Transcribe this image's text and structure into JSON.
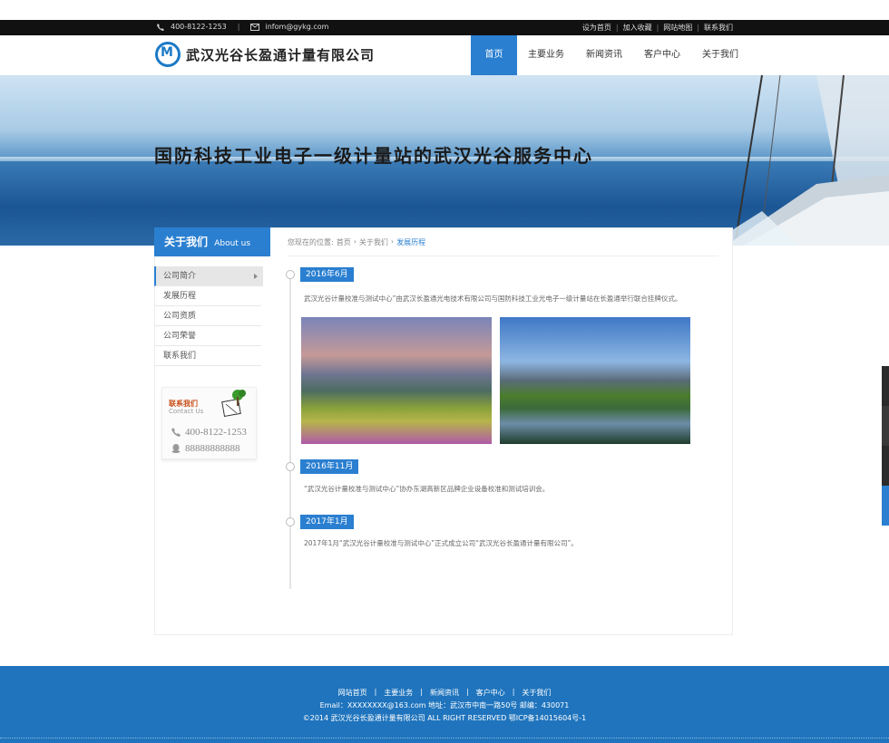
{
  "topbar": {
    "phone": "400-8122-1253",
    "email": "infom@gykg.com",
    "links": [
      "设为首页",
      "加入收藏",
      "网站地图",
      "联系我们"
    ]
  },
  "header": {
    "company_name": "武汉光谷长盈通计量有限公司",
    "nav": [
      "首页",
      "主要业务",
      "新闻资讯",
      "客户中心",
      "关于我们"
    ],
    "active_nav": "首页"
  },
  "banner": {
    "slogan": "国防科技工业电子一级计量站的武汉光谷服务中心"
  },
  "sidebar": {
    "title": "关于我们",
    "title_en": "About us",
    "items": [
      "公司简介",
      "发展历程",
      "公司资质",
      "公司荣誉",
      "联系我们"
    ],
    "active_item": "公司简介",
    "contact": {
      "title": "联系我们",
      "title_en": "Contact Us",
      "phone": "400-8122-1253",
      "qq": "88888888888"
    }
  },
  "breadcrumb": {
    "prefix": "您现在的位置:",
    "items": [
      "首页",
      "关于我们",
      "发展历程"
    ]
  },
  "timeline": [
    {
      "date": "2016年6月",
      "text": "武汉光谷计量校准与测试中心”由武汉长盈通光电技术有限公司与国防科技工业光电子一级计量站在长盈通举行联合挂牌仪式。"
    },
    {
      "date": "2016年11月",
      "text": "“武汉光谷计量校准与测试中心”协办东湖高新区品牌企业设备校准和测试培训会。"
    },
    {
      "date": "2017年1月",
      "text": "2017年1月“武汉光谷计量校准与测试中心”正式成立公司“武汉光谷长盈通计量有限公司”。"
    }
  ],
  "footer": {
    "links": [
      "网站首页",
      "主要业务",
      "新闻资讯",
      "客户中心",
      "关于我们"
    ],
    "contact_line": "Email：XXXXXXXX@163.com    地址：武汉市中南一路50号    邮编：430071",
    "copyright": "©2014 武汉光谷长盈通计量有限公司 ALL RIGHT RESERVED      鄂ICP备14015604号-1"
  },
  "colors": {
    "accent": "#2a7fd0",
    "footer_bg": "#1f74bd",
    "topbar_bg": "#111111"
  }
}
